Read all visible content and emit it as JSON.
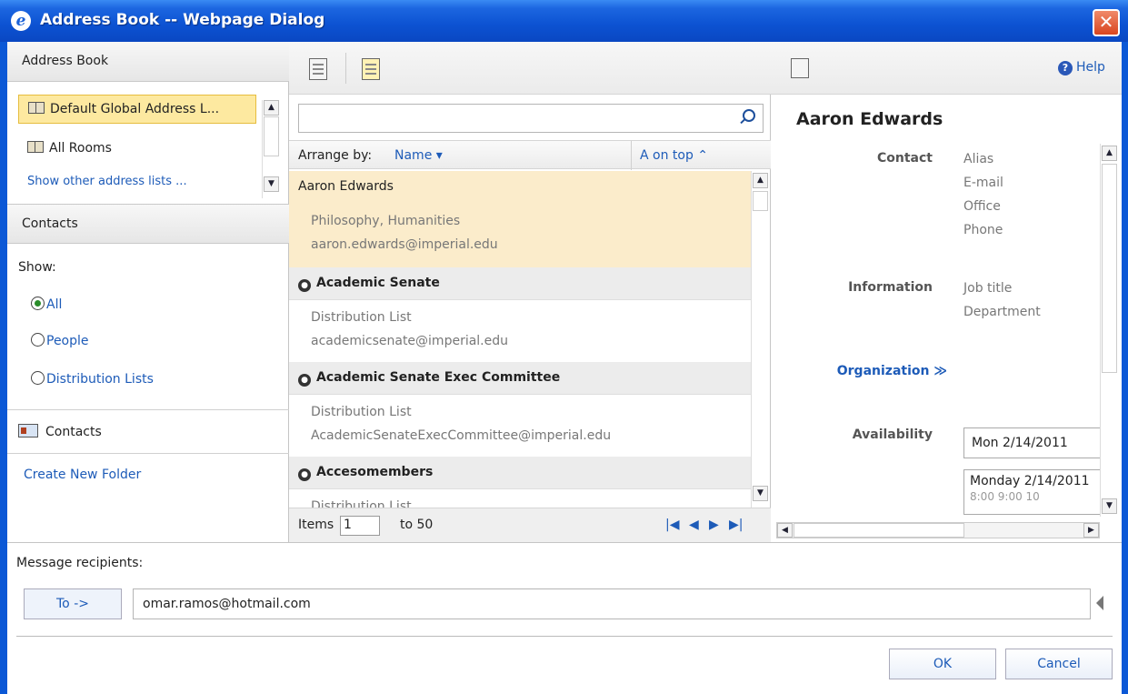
{
  "window": {
    "title": "Address Book -- Webpage Dialog",
    "close_glyph": "✕"
  },
  "left": {
    "address_book_header": "Address Book",
    "address_book_items": [
      {
        "label": "Default Global Address L...",
        "selected": true
      },
      {
        "label": "All Rooms",
        "selected": false
      },
      {
        "label": "Show other address lists ...",
        "selected": false
      }
    ],
    "contacts_header": "Contacts",
    "show_label": "Show:",
    "show_options": [
      {
        "label": "All",
        "checked": true
      },
      {
        "label": "People",
        "checked": false
      },
      {
        "label": "Distribution Lists",
        "checked": false
      }
    ],
    "contacts_folder": "Contacts",
    "create_folder": "Create New Folder"
  },
  "middle": {
    "search_placeholder": "",
    "arrange_label": "Arrange by:",
    "arrange_value": "Name ▾",
    "arrange_order": "A on top  ⌃",
    "results": [
      {
        "name": "Aaron Edwards",
        "line1": "Philosophy, Humanities",
        "line2": "aaron.edwards@imperial.edu",
        "selected": true,
        "is_list": false
      },
      {
        "name": "Academic Senate",
        "line1": "Distribution List",
        "line2": "academicsenate@imperial.edu",
        "selected": false,
        "is_list": true
      },
      {
        "name": "Academic Senate Exec Committee",
        "line1": "Distribution List",
        "line2": "AcademicSenateExecCommittee@imperial.edu",
        "selected": false,
        "is_list": true
      },
      {
        "name": "Accesomembers",
        "line1": "Distribution List",
        "line2": "",
        "selected": false,
        "is_list": true
      }
    ],
    "items_label": "Items",
    "items_from": "1",
    "items_to": "to 50"
  },
  "right": {
    "help_label": "Help",
    "contact_name": "Aaron Edwards",
    "contact_section": "Contact",
    "contact_fields": [
      "Alias",
      "E-mail",
      "Office",
      "Phone"
    ],
    "information_section": "Information",
    "information_fields": [
      "Job title",
      "Department"
    ],
    "organization_link": "Organization ≫",
    "availability_section": "Availability",
    "availability_date": "Mon 2/14/2011",
    "schedule_day": "Monday 2/14/2011",
    "schedule_times": "8:00    9:00    10"
  },
  "bottom": {
    "recipients_label": "Message recipients:",
    "to_button": "To ->",
    "recipients_value": "omar.ramos@hotmail.com",
    "ok_label": "OK",
    "cancel_label": "Cancel"
  }
}
